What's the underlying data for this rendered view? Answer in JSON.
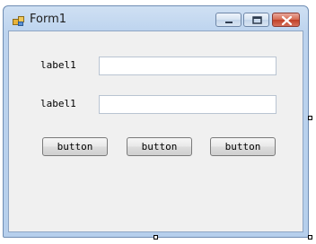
{
  "window": {
    "title": "Form1",
    "icon": "form-app-icon",
    "controls": {
      "minimize": "minimize-icon",
      "maximize": "maximize-icon",
      "close": "close-icon"
    }
  },
  "form": {
    "labels": [
      "label1",
      "label1"
    ],
    "textboxes": [
      {
        "value": ""
      },
      {
        "value": ""
      }
    ],
    "buttons": [
      "button",
      "button",
      "button"
    ]
  },
  "colors": {
    "client_background": "#f0f0f0",
    "frame": "#b6cfec",
    "close_button": "#c13f26"
  }
}
